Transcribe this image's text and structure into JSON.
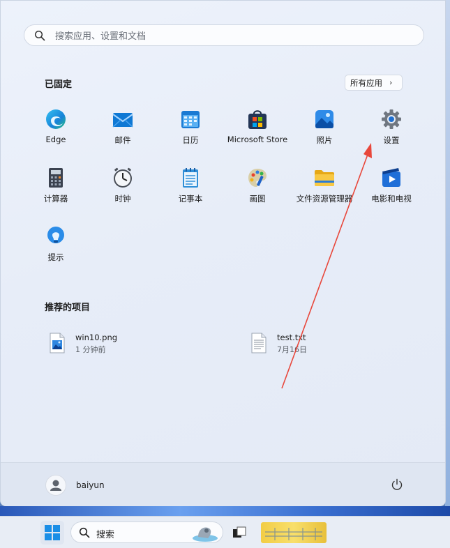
{
  "search": {
    "placeholder": "搜索应用、设置和文档"
  },
  "pinned": {
    "title": "已固定",
    "all_apps_label": "所有应用",
    "apps": [
      {
        "label": "Edge",
        "icon": "edge-icon"
      },
      {
        "label": "邮件",
        "icon": "mail-icon"
      },
      {
        "label": "日历",
        "icon": "calendar-icon"
      },
      {
        "label": "Microsoft Store",
        "icon": "store-icon"
      },
      {
        "label": "照片",
        "icon": "photos-icon"
      },
      {
        "label": "设置",
        "icon": "settings-gear-icon"
      },
      {
        "label": "计算器",
        "icon": "calculator-icon"
      },
      {
        "label": "时钟",
        "icon": "clock-icon"
      },
      {
        "label": "记事本",
        "icon": "notepad-icon"
      },
      {
        "label": "画图",
        "icon": "paint-icon"
      },
      {
        "label": "文件资源管理器",
        "icon": "folder-icon"
      },
      {
        "label": "电影和电视",
        "icon": "movies-tv-icon"
      },
      {
        "label": "提示",
        "icon": "tips-bulb-icon"
      }
    ]
  },
  "recommended": {
    "title": "推荐的项目",
    "items": [
      {
        "name": "win10.png",
        "time": "1 分钟前",
        "icon": "image-file-icon"
      },
      {
        "name": "test.txt",
        "time": "7月16日",
        "icon": "text-file-icon"
      }
    ]
  },
  "user": {
    "name": "baiyun"
  },
  "taskbar": {
    "search_label": "搜索"
  },
  "colors": {
    "accent": "#0067c0",
    "annotation_arrow": "#e8473b"
  }
}
